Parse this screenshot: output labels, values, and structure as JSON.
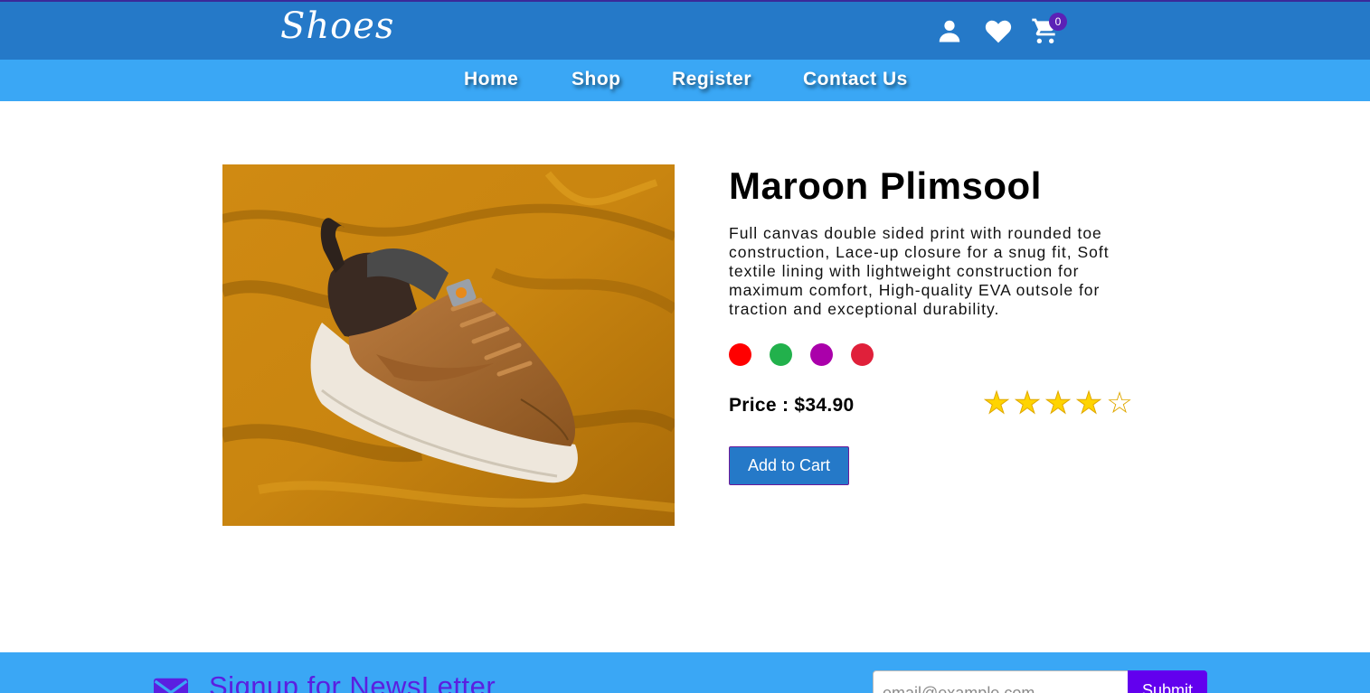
{
  "header": {
    "logo": "Shoes",
    "icons": [
      "user-icon",
      "heart-icon",
      "cart-icon"
    ],
    "cart_count": "0"
  },
  "nav": {
    "items": [
      {
        "label": "Home"
      },
      {
        "label": "Shop"
      },
      {
        "label": "Register"
      },
      {
        "label": "Contact Us"
      }
    ]
  },
  "product": {
    "title": "Maroon Plimsool",
    "description": "Full canvas double sided print with rounded toe construction, Lace-up closure for a snug fit, Soft textile lining with lightweight construction for maximum comfort, High-quality EVA outsole for traction and exceptional durability.",
    "colors": [
      "#ff0000",
      "#22b14c",
      "#aa00aa",
      "#e0203a"
    ],
    "price_label": "Price : $34.90",
    "rating": 4,
    "rating_max": 5,
    "add_to_cart_label": "Add to Cart"
  },
  "newsletter": {
    "heading": "Signup for NewsLetter",
    "email_placeholder": "email@example.com",
    "submit_label": "Submit"
  },
  "theme": {
    "header_bg": "#2579c8",
    "nav_bg": "#3aa7f5",
    "accent_purple": "#6200ee"
  }
}
